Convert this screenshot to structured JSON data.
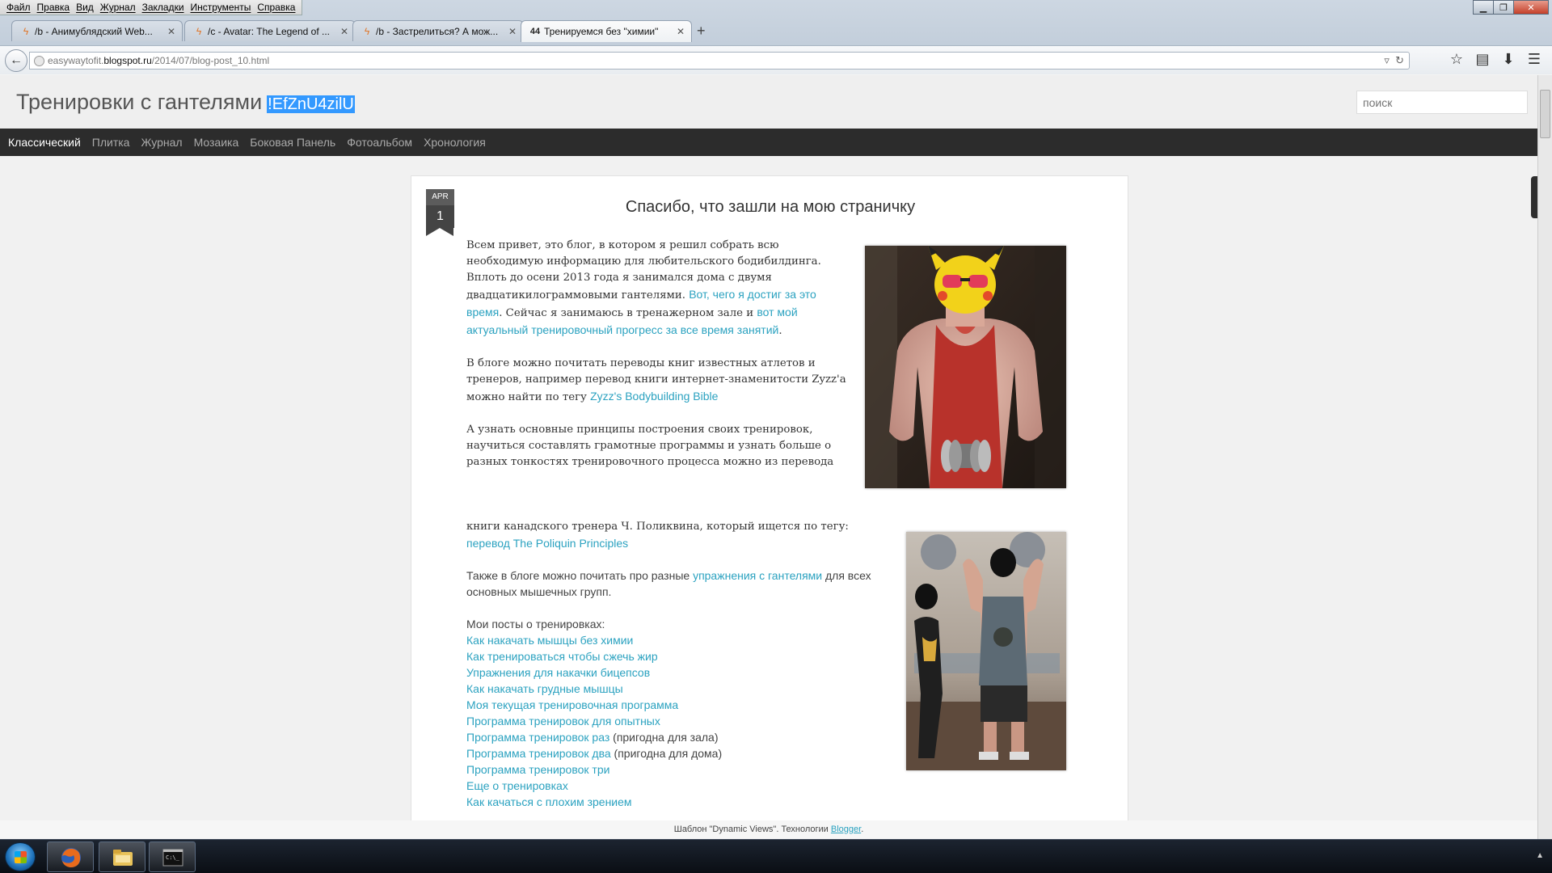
{
  "menubar": [
    "Файл",
    "Правка",
    "Вид",
    "Журнал",
    "Закладки",
    "Инструменты",
    "Справка"
  ],
  "tabs": [
    {
      "title": "/b - Анимублядский Web...",
      "icon": "flame-icon"
    },
    {
      "title": "/c - Avatar: The Legend of ...",
      "icon": "flame-icon"
    },
    {
      "title": "/b - Застрелиться? А мож...",
      "icon": "flame-icon"
    },
    {
      "title": "Тренируемся без \"химии\"",
      "icon": "blog-icon"
    }
  ],
  "url": {
    "prefix": "easywaytofit.",
    "domain": "blogspot.ru",
    "path": "/2014/07/blog-post_10.html"
  },
  "blog": {
    "title": "Тренировки с гантелями",
    "selected_text": "!EfZnU4zilU",
    "search_placeholder": "поиск"
  },
  "views": [
    "Классический",
    "Плитка",
    "Журнал",
    "Мозаика",
    "Боковая Панель",
    "Фотоальбом",
    "Хронология"
  ],
  "post": {
    "month": "APR",
    "day": "1",
    "title": "Спасибо, что зашли на мою страничку",
    "p1_text1": "Всем привет, это блог, в котором я решил собрать всю необходимую информацию для любительского бодибилдинга. Вплоть до осени 2013 года я занимался дома с двумя двадцатикилограммовыми гантелями. ",
    "p1_link1": "Вот, чего я достиг за это время",
    "p1_text2": ". Сейчас я занимаюсь в тренажерном зале и ",
    "p1_link2": "вот мой актуальный тренировочный прогресс за все время занятий",
    "p1_text3": ".",
    "p2_text1": "В блоге можно почитать переводы книг известных атлетов и тренеров, например перевод книги интернет-знаменитости Zyzz'a можно найти по тегу ",
    "p2_link1": "Zyzz's Bodybuilding Bible",
    "p3_text1": "А узнать основные принципы построения своих тренировок, научиться составлять грамотные программы и узнать больше о разных тонкостях тренировочного процесса можно из перевода",
    "p4_text1": "книги канадского тренера Ч. Поликвина, который ищется по тегу: ",
    "p4_link1": "перевод The Poliquin Principles",
    "p5_text1": "Также в блоге можно почитать про разные ",
    "p5_link1": "упражнения с гантелями",
    "p5_text2": " для всех основных мышечных групп.",
    "posts_header": "Мои посты о тренировках:",
    "links": [
      {
        "link": "Как накачать мышцы без химии",
        "suffix": ""
      },
      {
        "link": "Как тренироваться чтобы сжечь жир",
        "suffix": ""
      },
      {
        "link": "Упражнения для накачки бицепсов",
        "suffix": ""
      },
      {
        "link": "Как накачать грудные мышцы",
        "suffix": ""
      },
      {
        "link": "Моя текущая тренировочная программа",
        "suffix": ""
      },
      {
        "link": "Программа тренировок для опытных",
        "suffix": ""
      },
      {
        "link": "Программа тренировок раз",
        "suffix": " (пригодна для зала)"
      },
      {
        "link": "Программа тренировок два",
        "suffix": " (пригодна для дома)"
      },
      {
        "link": "Программа тренировок три",
        "suffix": ""
      },
      {
        "link": "Еще о тренировках",
        "suffix": ""
      },
      {
        "link": "Как качаться с плохим зрением",
        "suffix": ""
      }
    ]
  },
  "footer": {
    "text": "Шаблон \"Dynamic Views\". Технологии ",
    "link": "Blogger",
    "end": "."
  },
  "colors": {
    "link": "#2ba2c0",
    "viewbar": "#2c2c2c",
    "selection": "#3399ff"
  }
}
